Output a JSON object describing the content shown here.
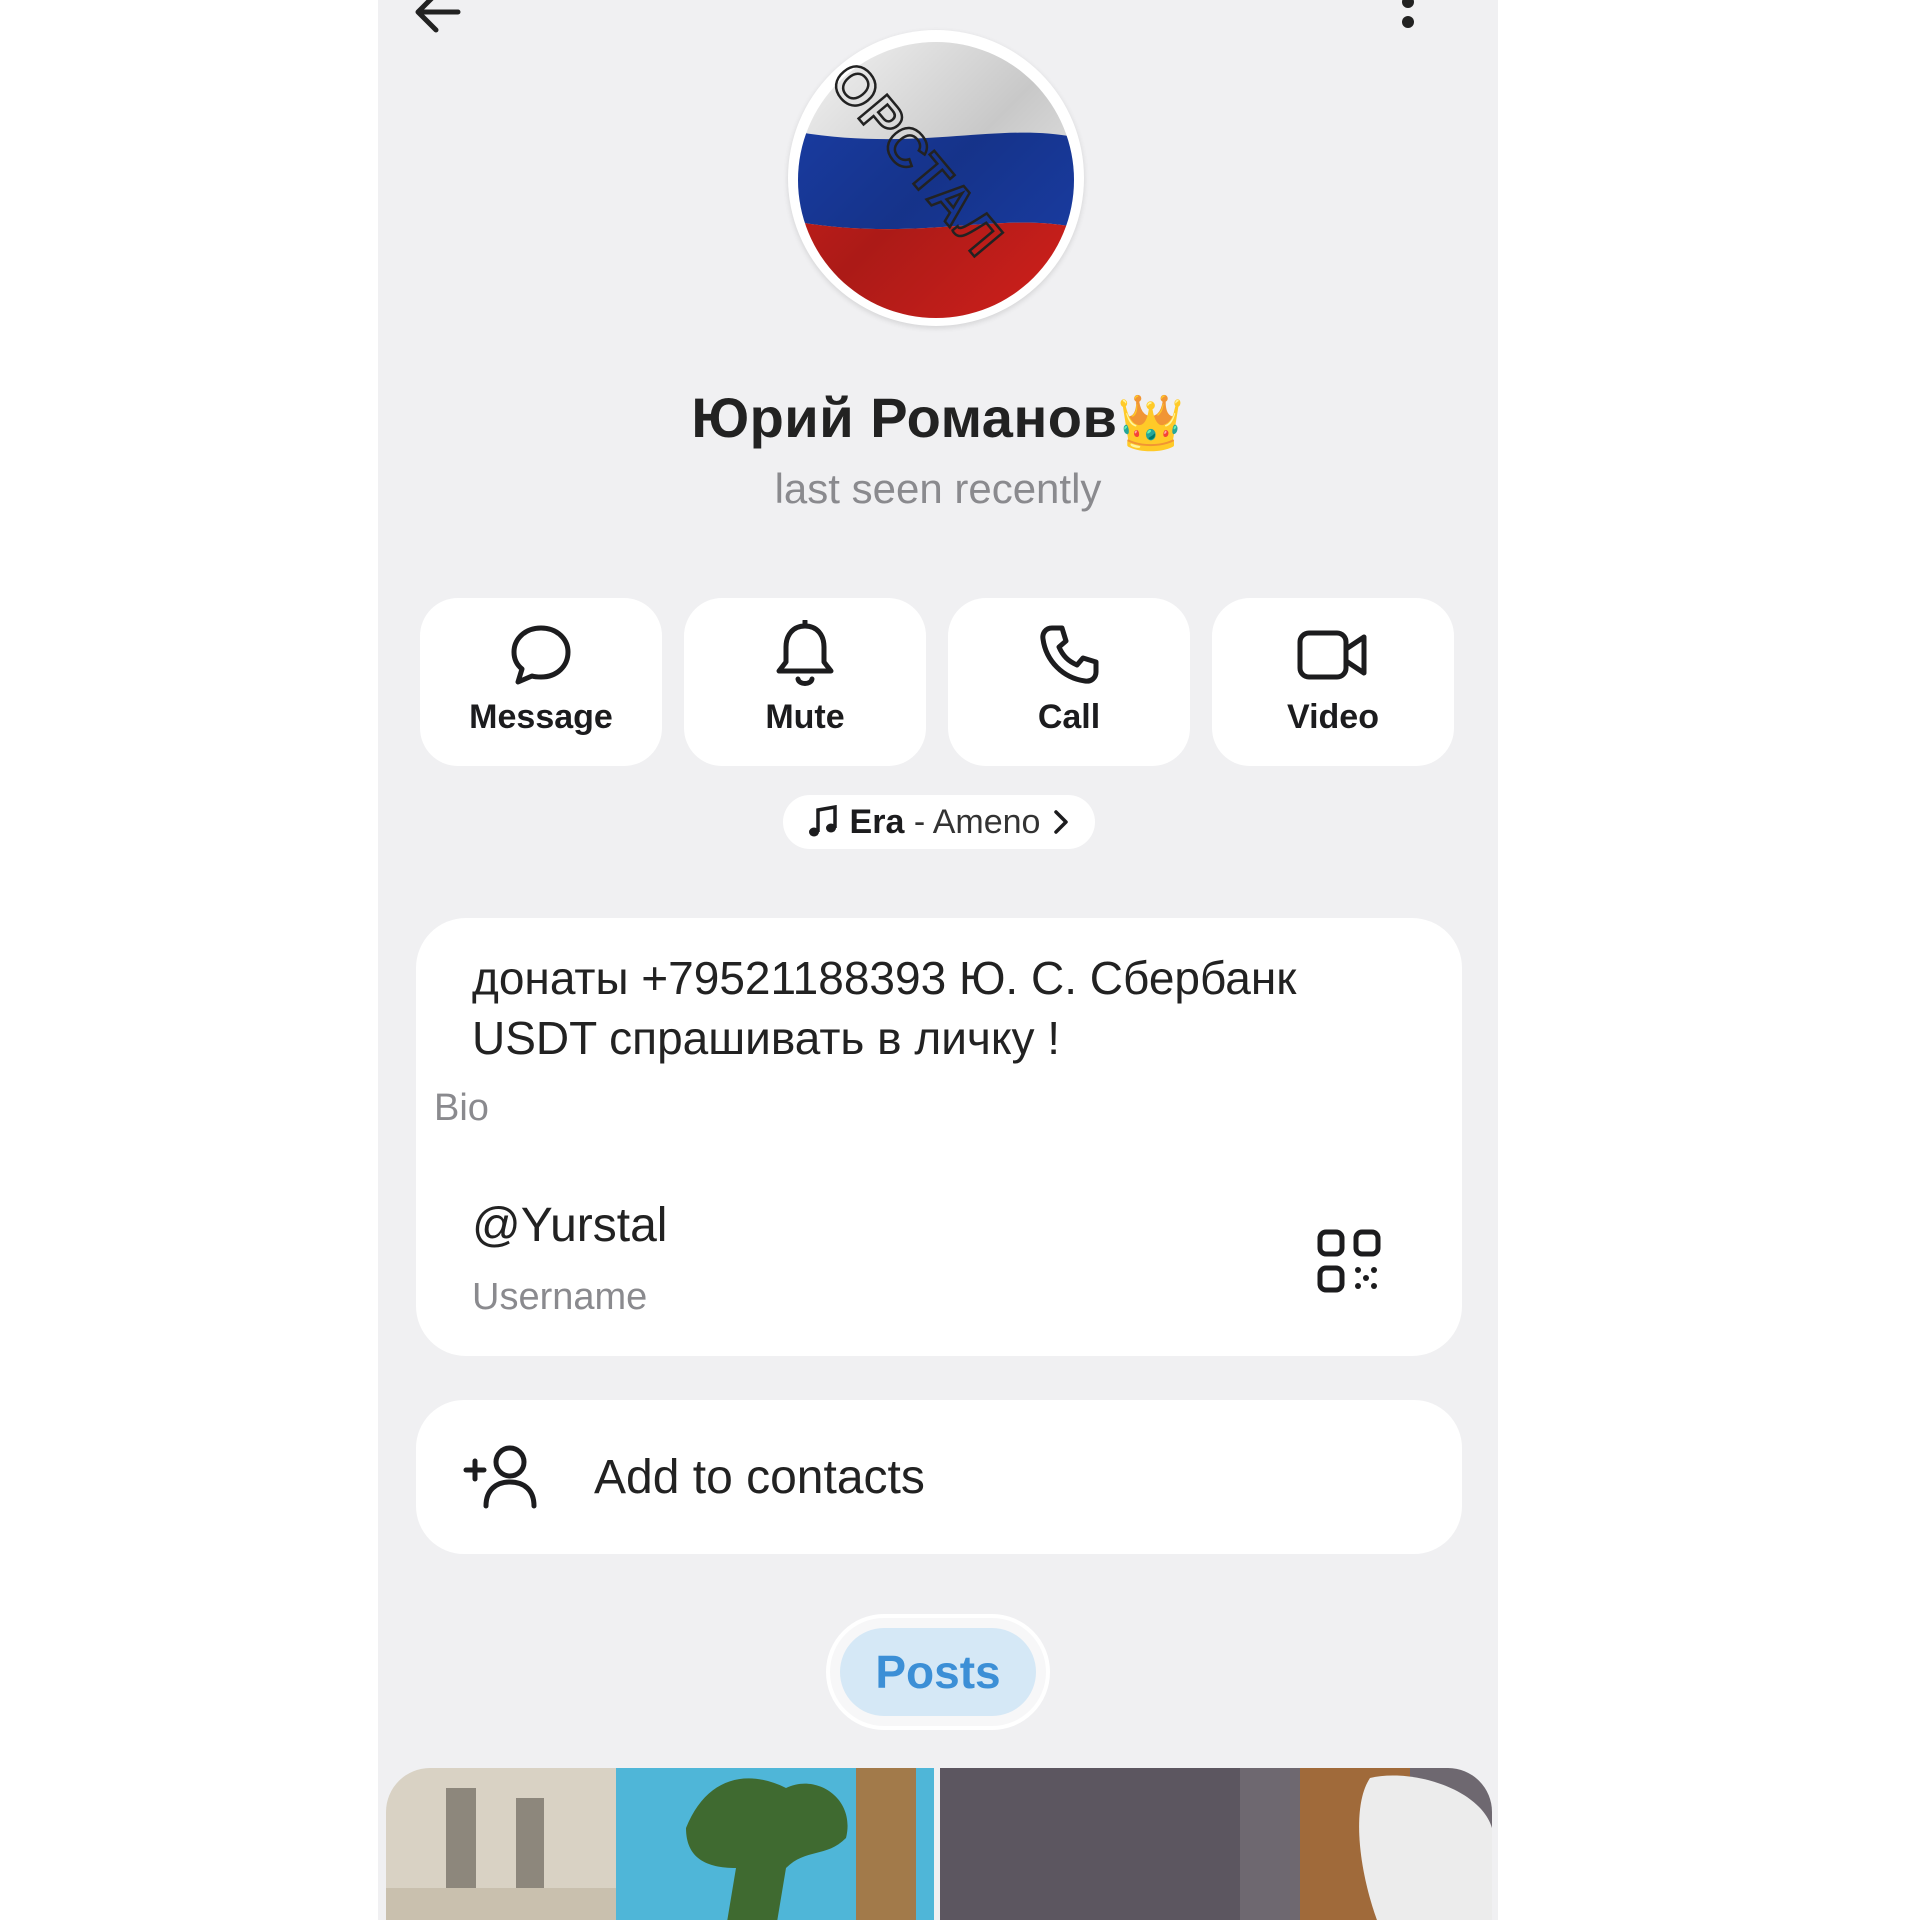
{
  "profile": {
    "name": "Юрий Романов",
    "crown": "👑",
    "status": "last seen recently",
    "avatar_overlay_text": "ОРСТАЛ",
    "avatar_flag_colors": [
      "#ffffff",
      "#1a3ea8",
      "#d1201c"
    ]
  },
  "actions": [
    {
      "label": "Message",
      "icon": "chat-bubble-icon"
    },
    {
      "label": "Mute",
      "icon": "bell-icon"
    },
    {
      "label": "Call",
      "icon": "phone-icon"
    },
    {
      "label": "Video",
      "icon": "video-camera-icon"
    }
  ],
  "music": {
    "icon": "music-note-icon",
    "artist": "Era",
    "separator": " - ",
    "song": "Ameno"
  },
  "info": {
    "bio": "донаты +79521188393 Ю. С. Сбербанк USDT спрашивать в личку !",
    "bio_label": "Bio",
    "username": "@Yurstal",
    "username_label": "Username"
  },
  "add_contact": {
    "label": "Add to contacts",
    "icon": "add-person-icon"
  },
  "tabs": {
    "active": "Posts"
  },
  "colors": {
    "background": "#f0f0f2",
    "card": "#ffffff",
    "accent": "#3c8fd6",
    "tab_bg": "#d5e8f6",
    "secondary_text": "#8a8a8e"
  }
}
